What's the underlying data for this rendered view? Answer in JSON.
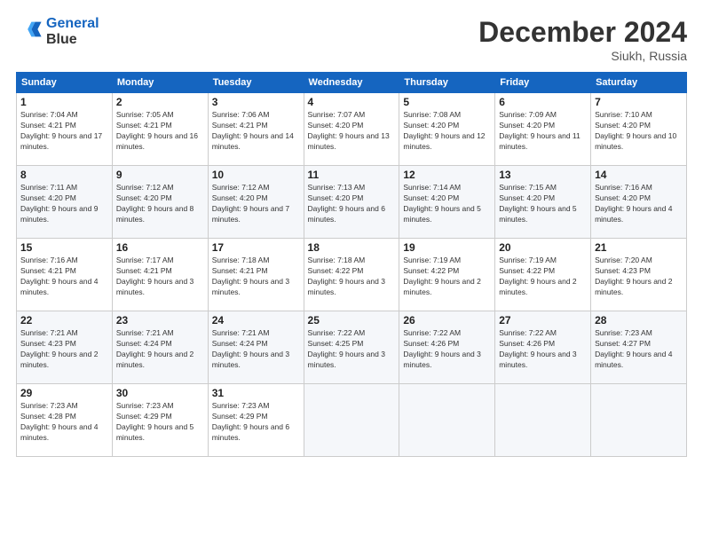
{
  "header": {
    "logo_line1": "General",
    "logo_line2": "Blue",
    "month": "December 2024",
    "location": "Siukh, Russia"
  },
  "weekdays": [
    "Sunday",
    "Monday",
    "Tuesday",
    "Wednesday",
    "Thursday",
    "Friday",
    "Saturday"
  ],
  "weeks": [
    [
      {
        "day": "1",
        "sunrise": "Sunrise: 7:04 AM",
        "sunset": "Sunset: 4:21 PM",
        "daylight": "Daylight: 9 hours and 17 minutes."
      },
      {
        "day": "2",
        "sunrise": "Sunrise: 7:05 AM",
        "sunset": "Sunset: 4:21 PM",
        "daylight": "Daylight: 9 hours and 16 minutes."
      },
      {
        "day": "3",
        "sunrise": "Sunrise: 7:06 AM",
        "sunset": "Sunset: 4:21 PM",
        "daylight": "Daylight: 9 hours and 14 minutes."
      },
      {
        "day": "4",
        "sunrise": "Sunrise: 7:07 AM",
        "sunset": "Sunset: 4:20 PM",
        "daylight": "Daylight: 9 hours and 13 minutes."
      },
      {
        "day": "5",
        "sunrise": "Sunrise: 7:08 AM",
        "sunset": "Sunset: 4:20 PM",
        "daylight": "Daylight: 9 hours and 12 minutes."
      },
      {
        "day": "6",
        "sunrise": "Sunrise: 7:09 AM",
        "sunset": "Sunset: 4:20 PM",
        "daylight": "Daylight: 9 hours and 11 minutes."
      },
      {
        "day": "7",
        "sunrise": "Sunrise: 7:10 AM",
        "sunset": "Sunset: 4:20 PM",
        "daylight": "Daylight: 9 hours and 10 minutes."
      }
    ],
    [
      {
        "day": "8",
        "sunrise": "Sunrise: 7:11 AM",
        "sunset": "Sunset: 4:20 PM",
        "daylight": "Daylight: 9 hours and 9 minutes."
      },
      {
        "day": "9",
        "sunrise": "Sunrise: 7:12 AM",
        "sunset": "Sunset: 4:20 PM",
        "daylight": "Daylight: 9 hours and 8 minutes."
      },
      {
        "day": "10",
        "sunrise": "Sunrise: 7:12 AM",
        "sunset": "Sunset: 4:20 PM",
        "daylight": "Daylight: 9 hours and 7 minutes."
      },
      {
        "day": "11",
        "sunrise": "Sunrise: 7:13 AM",
        "sunset": "Sunset: 4:20 PM",
        "daylight": "Daylight: 9 hours and 6 minutes."
      },
      {
        "day": "12",
        "sunrise": "Sunrise: 7:14 AM",
        "sunset": "Sunset: 4:20 PM",
        "daylight": "Daylight: 9 hours and 5 minutes."
      },
      {
        "day": "13",
        "sunrise": "Sunrise: 7:15 AM",
        "sunset": "Sunset: 4:20 PM",
        "daylight": "Daylight: 9 hours and 5 minutes."
      },
      {
        "day": "14",
        "sunrise": "Sunrise: 7:16 AM",
        "sunset": "Sunset: 4:20 PM",
        "daylight": "Daylight: 9 hours and 4 minutes."
      }
    ],
    [
      {
        "day": "15",
        "sunrise": "Sunrise: 7:16 AM",
        "sunset": "Sunset: 4:21 PM",
        "daylight": "Daylight: 9 hours and 4 minutes."
      },
      {
        "day": "16",
        "sunrise": "Sunrise: 7:17 AM",
        "sunset": "Sunset: 4:21 PM",
        "daylight": "Daylight: 9 hours and 3 minutes."
      },
      {
        "day": "17",
        "sunrise": "Sunrise: 7:18 AM",
        "sunset": "Sunset: 4:21 PM",
        "daylight": "Daylight: 9 hours and 3 minutes."
      },
      {
        "day": "18",
        "sunrise": "Sunrise: 7:18 AM",
        "sunset": "Sunset: 4:22 PM",
        "daylight": "Daylight: 9 hours and 3 minutes."
      },
      {
        "day": "19",
        "sunrise": "Sunrise: 7:19 AM",
        "sunset": "Sunset: 4:22 PM",
        "daylight": "Daylight: 9 hours and 2 minutes."
      },
      {
        "day": "20",
        "sunrise": "Sunrise: 7:19 AM",
        "sunset": "Sunset: 4:22 PM",
        "daylight": "Daylight: 9 hours and 2 minutes."
      },
      {
        "day": "21",
        "sunrise": "Sunrise: 7:20 AM",
        "sunset": "Sunset: 4:23 PM",
        "daylight": "Daylight: 9 hours and 2 minutes."
      }
    ],
    [
      {
        "day": "22",
        "sunrise": "Sunrise: 7:21 AM",
        "sunset": "Sunset: 4:23 PM",
        "daylight": "Daylight: 9 hours and 2 minutes."
      },
      {
        "day": "23",
        "sunrise": "Sunrise: 7:21 AM",
        "sunset": "Sunset: 4:24 PM",
        "daylight": "Daylight: 9 hours and 2 minutes."
      },
      {
        "day": "24",
        "sunrise": "Sunrise: 7:21 AM",
        "sunset": "Sunset: 4:24 PM",
        "daylight": "Daylight: 9 hours and 3 minutes."
      },
      {
        "day": "25",
        "sunrise": "Sunrise: 7:22 AM",
        "sunset": "Sunset: 4:25 PM",
        "daylight": "Daylight: 9 hours and 3 minutes."
      },
      {
        "day": "26",
        "sunrise": "Sunrise: 7:22 AM",
        "sunset": "Sunset: 4:26 PM",
        "daylight": "Daylight: 9 hours and 3 minutes."
      },
      {
        "day": "27",
        "sunrise": "Sunrise: 7:22 AM",
        "sunset": "Sunset: 4:26 PM",
        "daylight": "Daylight: 9 hours and 3 minutes."
      },
      {
        "day": "28",
        "sunrise": "Sunrise: 7:23 AM",
        "sunset": "Sunset: 4:27 PM",
        "daylight": "Daylight: 9 hours and 4 minutes."
      }
    ],
    [
      {
        "day": "29",
        "sunrise": "Sunrise: 7:23 AM",
        "sunset": "Sunset: 4:28 PM",
        "daylight": "Daylight: 9 hours and 4 minutes."
      },
      {
        "day": "30",
        "sunrise": "Sunrise: 7:23 AM",
        "sunset": "Sunset: 4:29 PM",
        "daylight": "Daylight: 9 hours and 5 minutes."
      },
      {
        "day": "31",
        "sunrise": "Sunrise: 7:23 AM",
        "sunset": "Sunset: 4:29 PM",
        "daylight": "Daylight: 9 hours and 6 minutes."
      },
      null,
      null,
      null,
      null
    ]
  ]
}
